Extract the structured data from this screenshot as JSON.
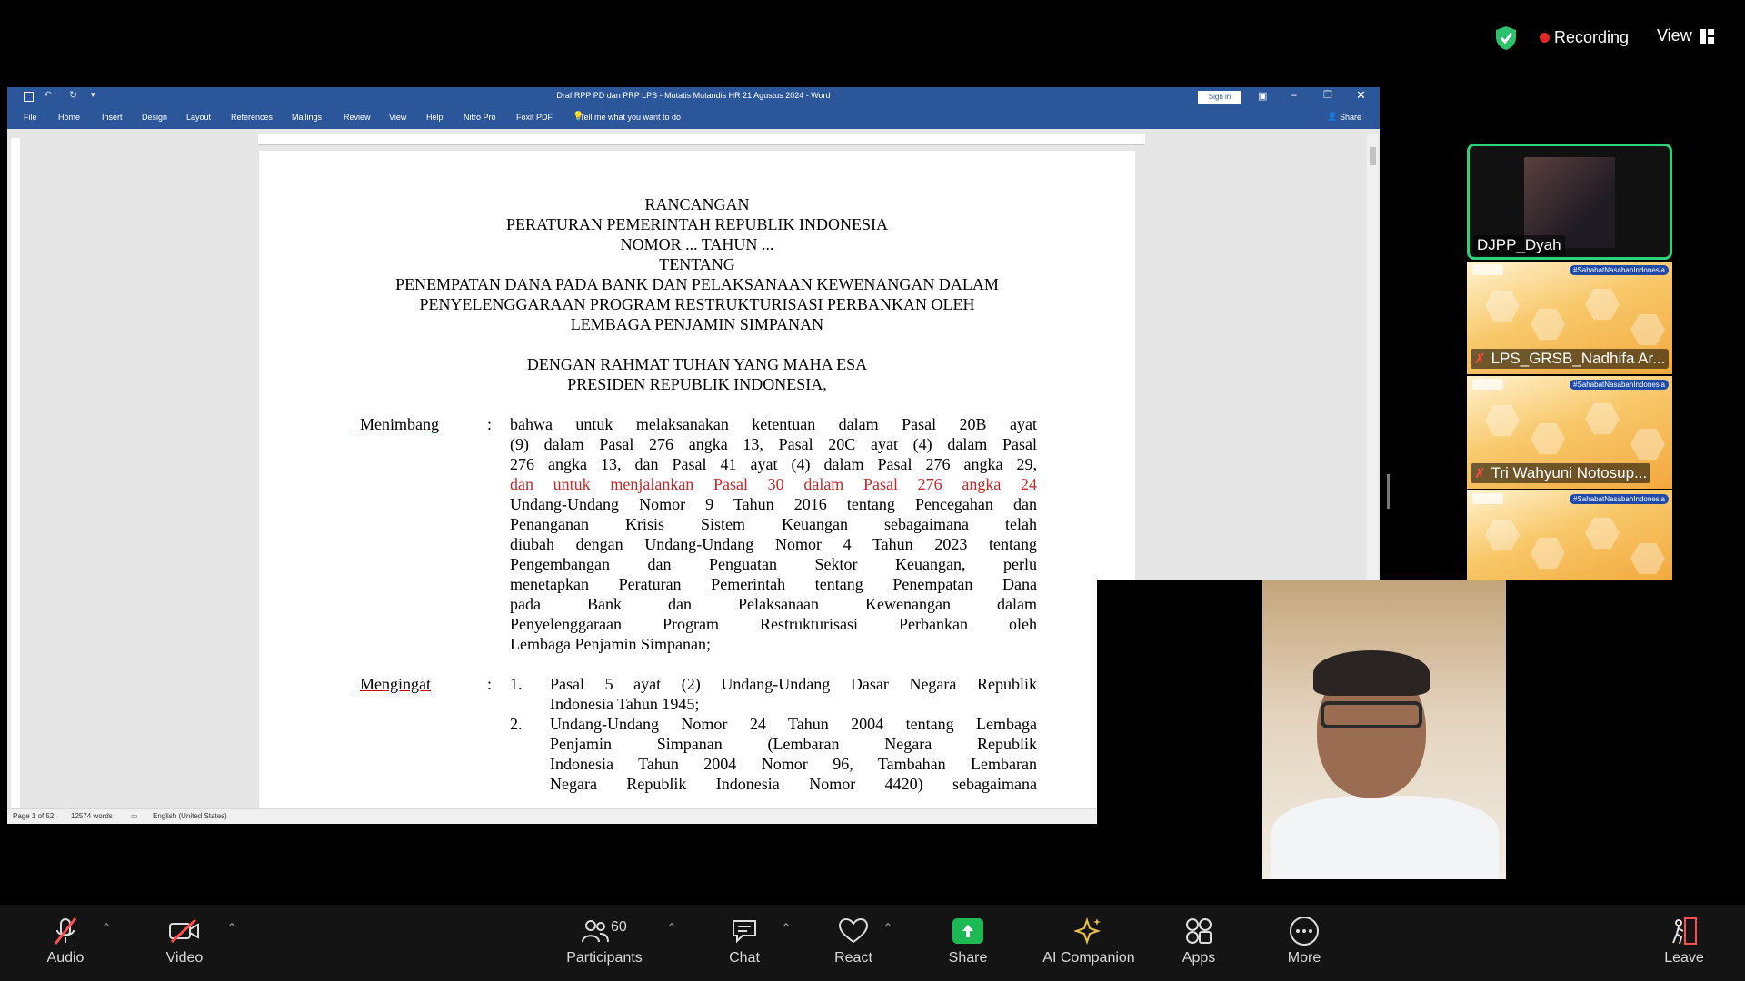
{
  "topbar": {
    "recording_label": "Recording",
    "view_label": "View",
    "recording_color": "#e02828",
    "shield_color": "#2cc06a"
  },
  "word": {
    "title": "Draf RPP PD dan PRP LPS - Mutatis Mutandis HR 21 Agustus 2024  -  Word",
    "sign_in": "Sign in",
    "menu": [
      "File",
      "Home",
      "Insert",
      "Design",
      "Layout",
      "References",
      "Mailings",
      "Review",
      "View",
      "Help",
      "Nitro Pro",
      "Foxit PDF"
    ],
    "tell_me": "Tell me what you want to do",
    "share": "Share",
    "accent": "#2b579a",
    "status": {
      "page": "Page 1 of 52",
      "words": "12574 words",
      "language": "English (United States)"
    }
  },
  "document": {
    "heading": [
      "RANCANGAN",
      "PERATURAN PEMERINTAH REPUBLIK INDONESIA",
      "NOMOR ... TAHUN ...",
      "TENTANG",
      "PENEMPATAN DANA PADA BANK DAN PELAKSANAAN KEWENANGAN DALAM",
      "PENYELENGGARAAN PROGRAM RESTRUKTURISASI PERBANKAN OLEH",
      "LEMBAGA PENJAMIN SIMPANAN"
    ],
    "opening": [
      "DENGAN RAHMAT TUHAN YANG MAHA ESA",
      "PRESIDEN REPUBLIK INDONESIA,"
    ],
    "menimbang_label": "Menimbang",
    "colon": ":",
    "menimbang_lines": [
      "bahwa untuk melaksanakan ketentuan dalam Pasal 20B ayat",
      "(9) dalam Pasal 276 angka 13, Pasal 20C ayat (4) dalam Pasal",
      "276 angka 13, dan Pasal 41 ayat (4) dalam Pasal 276 angka 29,",
      "dan untuk menjalankan Pasal 30 dalam Pasal 276 angka 24",
      "Undang-Undang Nomor 9 Tahun 2016 tentang Pencegahan dan",
      "Penanganan Krisis Sistem Keuangan sebagaimana telah",
      "diubah dengan Undang-Undang Nomor 4 Tahun 2023 tentang",
      "Pengembangan dan Penguatan Sektor Keuangan, perlu",
      "menetapkan Peraturan Pemerintah tentang Penempatan Dana",
      "pada Bank dan Pelaksanaan Kewenangan dalam",
      "Penyelenggaraan Program Restrukturisasi Perbankan oleh",
      "Lembaga Penjamin Simpanan;"
    ],
    "mengingat_label": "Mengingat",
    "mengingat_items": [
      {
        "num": "1.",
        "lines": [
          "Pasal 5 ayat (2) Undang-Undang Dasar Negara Republik",
          "Indonesia Tahun 1945;"
        ]
      },
      {
        "num": "2.",
        "lines": [
          "Undang-Undang Nomor 24 Tahun 2004 tentang Lembaga",
          "Penjamin Simpanan (Lembaran Negara Republik",
          "Indonesia Tahun 2004 Nomor 96, Tambahan Lembaran",
          "Negara Republik Indonesia Nomor 4420) sebagaimana"
        ]
      }
    ]
  },
  "participants": [
    {
      "name": "DJPP_Dyah",
      "active_speaker_color": "#2cd27a"
    },
    {
      "name": "LPS_GRSB_Nadhifa Ar...",
      "muted": true,
      "tag": "#SahabatNasabahIndonesia"
    },
    {
      "name": "Tri Wahyuni Notosup...",
      "muted": true,
      "tag": "#SahabatNasabahIndonesia"
    },
    {
      "name": "",
      "tag": "#SahabatNasabahIndonesia"
    }
  ],
  "toolbar": {
    "audio": "Audio",
    "video": "Video",
    "participants": "Participants",
    "participants_count": "60",
    "chat": "Chat",
    "react": "React",
    "share": "Share",
    "ai_companion": "AI Companion",
    "apps": "Apps",
    "more": "More",
    "leave": "Leave",
    "share_color": "#1db954",
    "muted_color": "#ff4d4d"
  }
}
